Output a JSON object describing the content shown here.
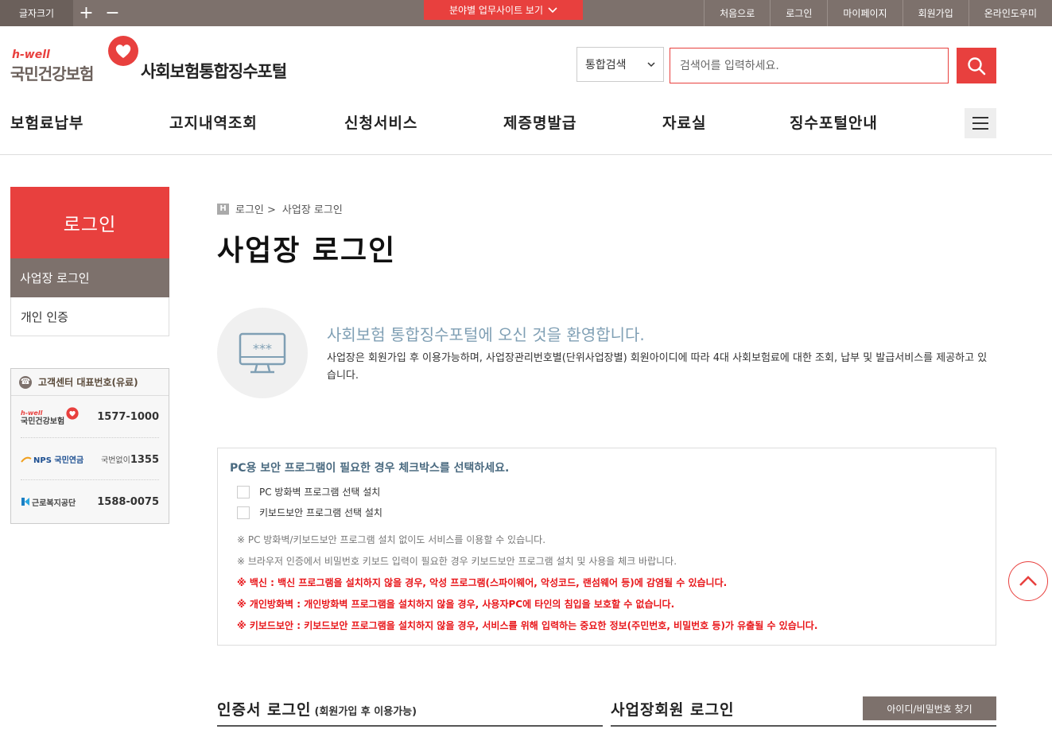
{
  "topbar": {
    "font_size_label": "글자크기",
    "font_increase": "+",
    "font_decrease": "−",
    "site_button": "분야별 업무사이트 보기",
    "links": [
      "처음으로",
      "로그인",
      "마이페이지",
      "회원가입",
      "온라인도우미"
    ]
  },
  "header": {
    "logo_hwell": "h-well",
    "logo_org": "국민건강보험",
    "portal_title": "사회보험통합징수포털",
    "search_select": "통합검색",
    "search_placeholder": "검색어를 입력하세요."
  },
  "gnb": [
    "보험료납부",
    "고지내역조회",
    "신청서비스",
    "제증명발급",
    "자료실",
    "징수포털안내"
  ],
  "sidebar": {
    "title": "로그인",
    "items": [
      "사업장 로그인",
      "개인 인증"
    ],
    "cs_title": "고객센터 대표번호(유료)",
    "cs_rows": [
      {
        "org": "국민건강보험",
        "prefix": "",
        "number": "1577-1000"
      },
      {
        "org": "NPS 국민연금",
        "prefix": "국번없이",
        "number": "1355"
      },
      {
        "org": "근로복지공단",
        "prefix": "",
        "number": "1588-0075"
      }
    ],
    "cs_hwell": "h-well"
  },
  "breadcrumb": {
    "home": "H",
    "level1": "로그인 >",
    "level2": "사업장 로그인"
  },
  "page_title": "사업장 로그인",
  "welcome": {
    "icon_text": "***",
    "heading": "사회보험 통합징수포털에 오신 것을 환영합니다.",
    "description": "사업장은 회원가입 후 이용가능하며, 사업장관리번호별(단위사업장별) 회원아이디에 따라 4대 사회보험료에 대한 조회, 납부 및 발급서비스를 제공하고 있습니다."
  },
  "security": {
    "title": "PC용 보안 프로그램이 필요한 경우 체크박스를 선택하세요.",
    "options": [
      "PC 방화벽 프로그램 선택 설치",
      "키보드보안 프로그램 선택 설치"
    ],
    "notes": [
      "※ PC 방화벽/키보드보안 프로그램 설치 없이도 서비스를 이용할 수 있습니다.",
      "※ 브라우저 인증에서 비밀번호 키보드 입력이 필요한 경우 키보드보안 프로그램 설치 및 사용을 체크 바랍니다."
    ],
    "warnings": [
      "※ 백신 : 백신 프로그램을 설치하지 않을 경우, 악성 프로그램(스파이웨어, 악성코드, 랜섬웨어 등)에 감염될 수 있습니다.",
      "※ 개인방화벽 : 개인방화벽 프로그램을 설치하지 않을 경우, 사용자PC에 타인의 침입을 보호할 수 없습니다.",
      "※ 키보드보안 : 키보드보안 프로그램을 설치하지 않을 경우, 서비스를 위해 입력하는 중요한 정보(주민번호, 비밀번호 등)가 유출될 수 있습니다."
    ]
  },
  "login_sections": {
    "cert_title": "인증서 로그인",
    "cert_sub": "(회원가입 후 이용가능)",
    "biz_title": "사업장회원 로그인",
    "find_button": "아이디/비밀번호 찾기"
  },
  "colors": {
    "accent": "#e8403e",
    "brown": "#7d716c",
    "info_blue": "#7f9fb4",
    "warning": "#e8161a"
  }
}
